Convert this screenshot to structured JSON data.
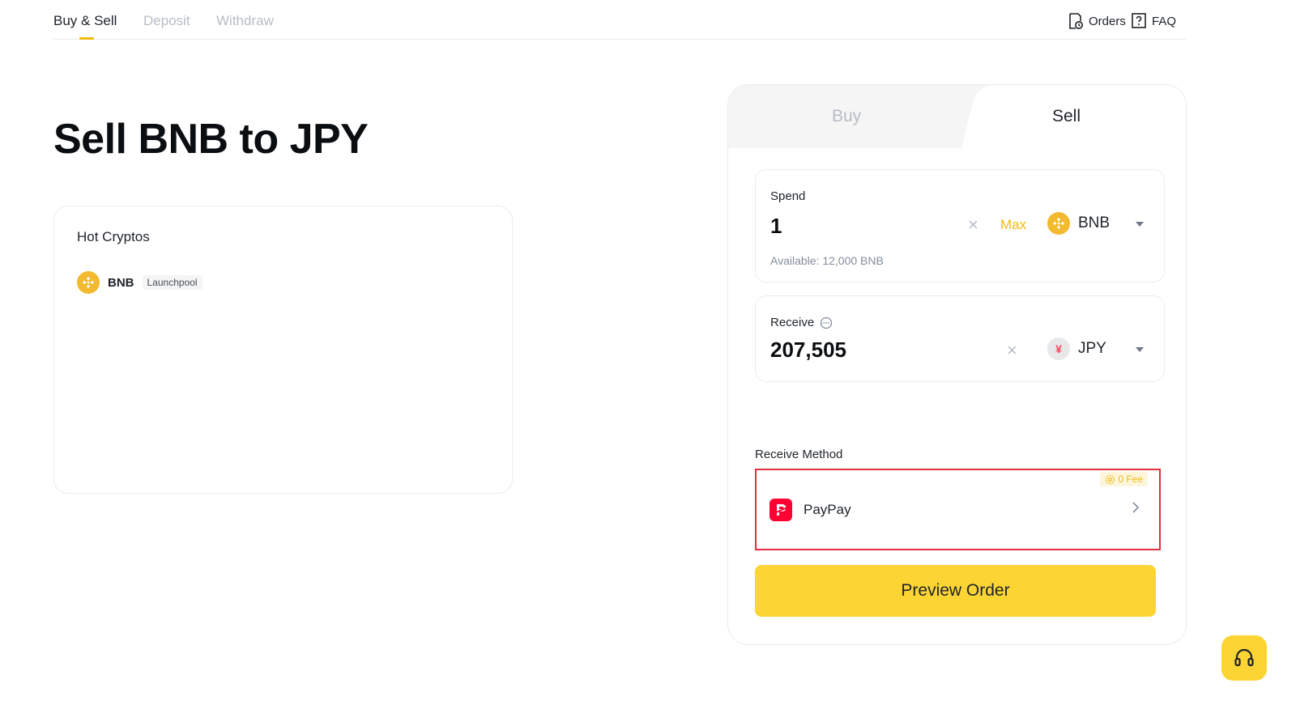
{
  "nav": {
    "tabs": [
      {
        "label": "Buy & Sell"
      },
      {
        "label": "Deposit"
      },
      {
        "label": "Withdraw"
      }
    ],
    "orders_label": "Orders",
    "faq_label": "FAQ"
  },
  "page_title": "Sell BNB to JPY",
  "hot_cryptos": {
    "title": "Hot Cryptos",
    "items": [
      {
        "symbol": "BNB",
        "badge": "Launchpool"
      }
    ]
  },
  "trade": {
    "tabs": {
      "buy": "Buy",
      "sell": "Sell"
    },
    "spend": {
      "label": "Spend",
      "amount": "1",
      "max_label": "Max",
      "currency": "BNB",
      "available": "Available: 12,000 BNB"
    },
    "receive": {
      "label": "Receive",
      "amount": "207,505",
      "currency": "JPY",
      "currency_symbol": "¥"
    },
    "method": {
      "label": "Receive Method",
      "fee_badge": "0 Fee",
      "name": "PayPay"
    },
    "preview_label": "Preview Order"
  },
  "colors": {
    "brand_yellow": "#fcd535",
    "accent_yellow": "#f0b90b",
    "highlight_red": "#e5303c",
    "paypay_red": "#ff0033"
  }
}
